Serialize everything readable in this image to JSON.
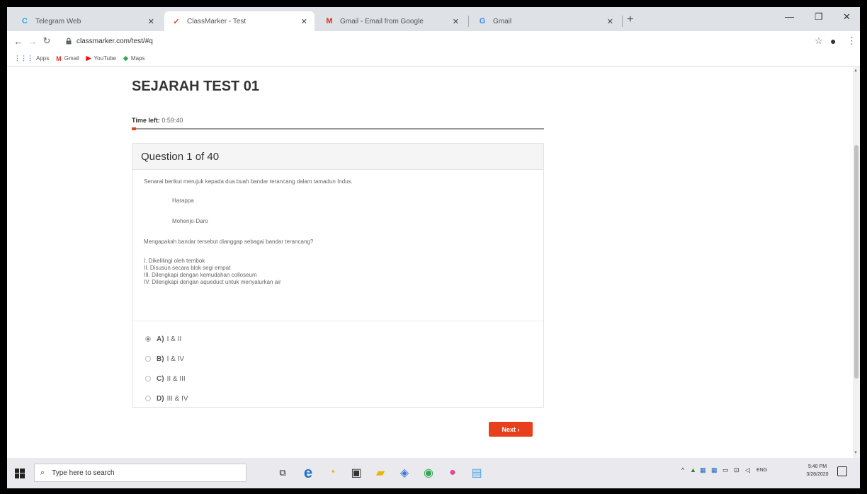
{
  "browser": {
    "tabs": [
      {
        "title": "Telegram Web",
        "icon": "telegram-icon",
        "active": false
      },
      {
        "title": "ClassMarker - Test",
        "icon": "classmarker-icon",
        "active": true
      },
      {
        "title": "Gmail - Email from Google",
        "icon": "gmail-icon",
        "active": false
      },
      {
        "title": "Gmail",
        "icon": "google-icon",
        "active": false
      }
    ],
    "url": "classmarker.com/test/#q",
    "bookmarks": [
      {
        "label": "Apps",
        "icon": "apps-grid-icon"
      },
      {
        "label": "Gmail",
        "icon": "gmail-icon"
      },
      {
        "label": "YouTube",
        "icon": "youtube-icon"
      },
      {
        "label": "Maps",
        "icon": "maps-icon"
      }
    ]
  },
  "test": {
    "title": "SEJARAH TEST 01",
    "time_left_label": "Time left:",
    "time_left_value": "0:59:40",
    "progress_fraction": 0.01
  },
  "question": {
    "header": "Question 1 of 40",
    "intro": "Senarai berikut merujuk kepada dua buah bandar terancang dalam tamadun Indus.",
    "items": [
      "Harappa",
      "Mohenjo-Daro"
    ],
    "ask": "Mengapakah bandar tersebut dianggap sebagai bandar terancang?",
    "statements": [
      "I. Dikelilingi oleh tembok",
      "II. Disusun secara blok segi empat",
      "III. Dilengkapi dengan kemudahan colloseum",
      "IV. Dilengkapi dengan aqueduct untuk menyalurkan air"
    ],
    "options": [
      {
        "letter": "A)",
        "text": "I & II",
        "selected": true
      },
      {
        "letter": "B)",
        "text": "I & IV",
        "selected": false
      },
      {
        "letter": "C)",
        "text": "II & III",
        "selected": false
      },
      {
        "letter": "D)",
        "text": "III & IV",
        "selected": false
      }
    ],
    "next_label": "Next ›"
  },
  "taskbar": {
    "search_placeholder": "Type here to search",
    "language": "ENG",
    "time": "5:40 PM",
    "date": "3/28/2020"
  },
  "colors": {
    "accent": "#e8401c"
  }
}
